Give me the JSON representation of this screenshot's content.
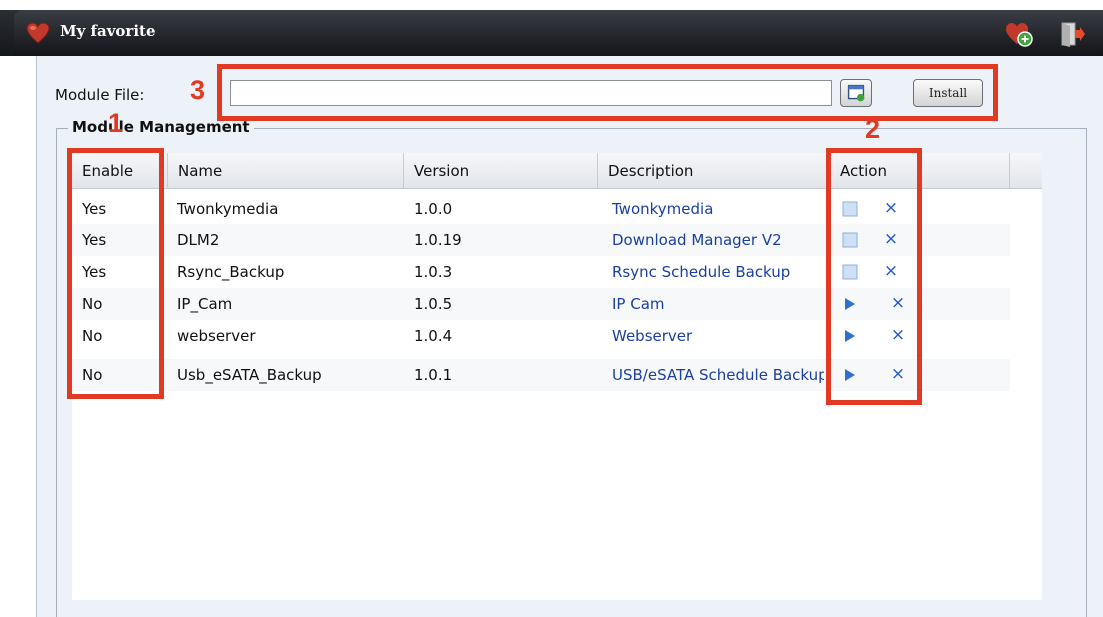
{
  "titlebar": {
    "title": "My favorite",
    "icons": [
      "heart-icon",
      "favorite-add-icon",
      "logout-icon"
    ]
  },
  "module_file": {
    "label": "Module File:",
    "input_value": "",
    "install_label": "Install"
  },
  "fieldset": {
    "legend": "Module Management"
  },
  "table": {
    "headers": {
      "enable": "Enable",
      "name": "Name",
      "version": "Version",
      "description": "Description",
      "action": "Action"
    },
    "rows": [
      {
        "enable": "Yes",
        "name": "Twonkymedia",
        "version": "1.0.0",
        "description": "Twonkymedia",
        "action": "stop"
      },
      {
        "enable": "Yes",
        "name": "DLM2",
        "version": "1.0.19",
        "description": "Download Manager V2",
        "action": "stop"
      },
      {
        "enable": "Yes",
        "name": "Rsync_Backup",
        "version": "1.0.3",
        "description": "Rsync Schedule Backup",
        "action": "stop"
      },
      {
        "enable": "No",
        "name": "IP_Cam",
        "version": "1.0.5",
        "description": "IP Cam",
        "action": "play"
      },
      {
        "enable": "No",
        "name": "webserver",
        "version": "1.0.4",
        "description": "Webserver",
        "action": "play"
      },
      {
        "enable": "No",
        "name": "Usb_eSATA_Backup",
        "version": "1.0.1",
        "description": "USB/eSATA Schedule Backup",
        "action": "play"
      }
    ]
  },
  "annotations": {
    "one": "1",
    "two": "2",
    "three": "3",
    "color": "#e03a25"
  },
  "colors": {
    "link": "#1b3fa0",
    "panel_bg": "#edf2f8",
    "titlebar": "#15171b"
  }
}
